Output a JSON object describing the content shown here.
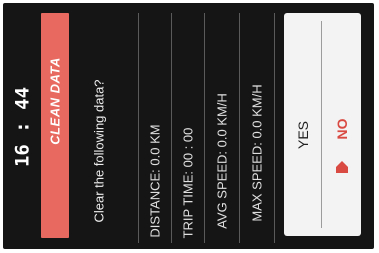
{
  "status": {
    "time": "16 : 44"
  },
  "header": {
    "title": "CLEAN DATA",
    "accent_color": "#e7695f"
  },
  "prompt": {
    "question": "Clear the following data?"
  },
  "stats": [
    {
      "label": "DISTANCE: 0.0 KM"
    },
    {
      "label": "TRIP TIME: 00 : 00"
    },
    {
      "label": "AVG SPEED: 0.0 KM/H"
    },
    {
      "label": "MAX SPEED: 0.0 KM/H"
    }
  ],
  "dialog": {
    "options": [
      {
        "label": "YES",
        "selected": false
      },
      {
        "label": "NO",
        "selected": true
      }
    ],
    "selected_color": "#d94a43",
    "selection_marker_icon": "pentagon-pointer-icon"
  }
}
